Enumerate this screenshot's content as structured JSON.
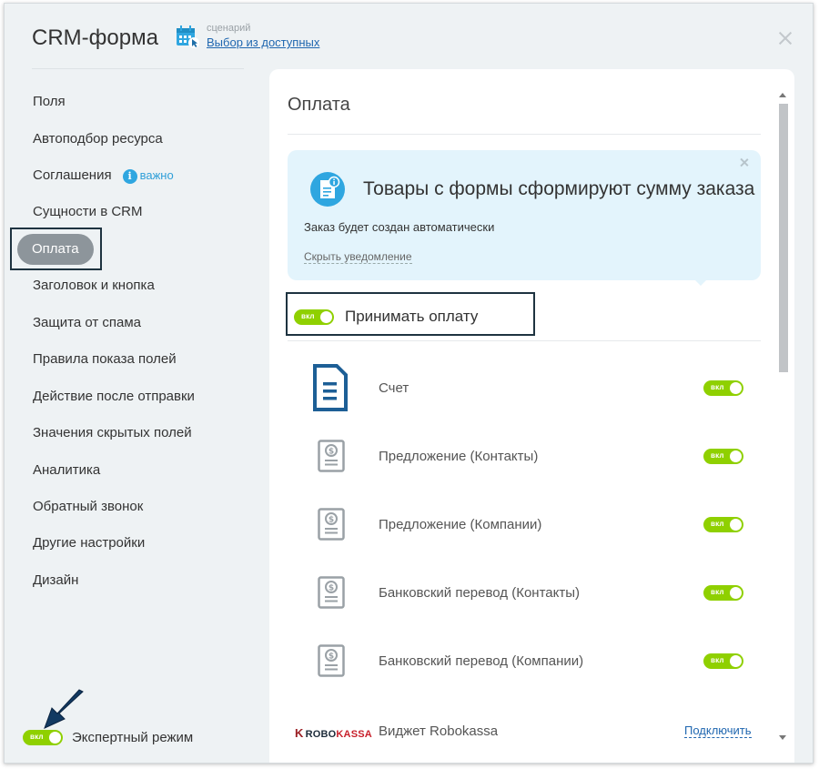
{
  "header": {
    "title": "CRM-форма",
    "scenario_caption": "сценарий",
    "scenario_link": "Выбор из доступных"
  },
  "sidebar": {
    "items": [
      {
        "label": "Поля"
      },
      {
        "label": "Автоподбор ресурса"
      },
      {
        "label": "Соглашения",
        "badge": "важно"
      },
      {
        "label": "Сущности в CRM"
      },
      {
        "label": "Оплата",
        "active": true
      },
      {
        "label": "Заголовок и кнопка"
      },
      {
        "label": "Защита от спама"
      },
      {
        "label": "Правила показа полей"
      },
      {
        "label": "Действие после отправки"
      },
      {
        "label": "Значения скрытых полей"
      },
      {
        "label": "Аналитика"
      },
      {
        "label": "Обратный звонок"
      },
      {
        "label": "Другие настройки"
      },
      {
        "label": "Дизайн"
      }
    ],
    "info_glyph": "i",
    "expert_mode": {
      "label": "Экспертный режим",
      "toggle_label": "вкл",
      "on": true
    }
  },
  "main": {
    "title": "Оплата",
    "notice": {
      "title": "Товары с формы сформируют сумму заказа",
      "text": "Заказ будет создан автоматически",
      "hide_link": "Скрыть уведомление"
    },
    "accept_payment": {
      "label": "Принимать оплату",
      "toggle_label": "вкл",
      "on": true
    },
    "payment_methods": [
      {
        "name": "Счет",
        "icon": "invoice-icon",
        "toggle_label": "вкл",
        "on": true
      },
      {
        "name": "Предложение (Контакты)",
        "icon": "dollar-document-icon",
        "toggle_label": "вкл",
        "on": true
      },
      {
        "name": "Предложение (Компании)",
        "icon": "dollar-document-icon",
        "toggle_label": "вкл",
        "on": true
      },
      {
        "name": "Банковский перевод (Контакты)",
        "icon": "dollar-document-icon",
        "toggle_label": "вкл",
        "on": true
      },
      {
        "name": "Банковский перевод (Компании)",
        "icon": "dollar-document-icon",
        "toggle_label": "вкл",
        "on": true
      },
      {
        "name": "Виджет Robokassa",
        "icon": "robokassa-logo",
        "logo_parts": [
          "ROBO",
          "KASSA"
        ],
        "action_link": "Подключить"
      }
    ]
  },
  "colors": {
    "toggle_on": "#8fd000",
    "link": "#2067b0",
    "notice_bg": "#e3f4fc",
    "active_nav": "#8d959b",
    "frame": "#1e3340"
  }
}
